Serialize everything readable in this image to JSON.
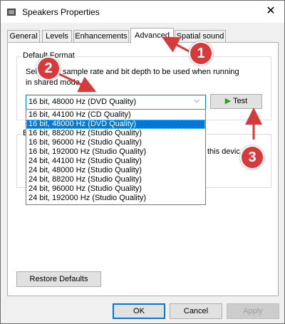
{
  "window": {
    "title": "Speakers Properties",
    "close_glyph": "✕"
  },
  "tabs": [
    {
      "label": "General"
    },
    {
      "label": "Levels"
    },
    {
      "label": "Enhancements"
    },
    {
      "label": "Advanced",
      "active": true
    },
    {
      "label": "Spatial sound"
    }
  ],
  "default_format": {
    "group_label": "Default Format",
    "description_line1": "Select the sample rate and bit depth to be used when running",
    "description_line2": "in shared mode.",
    "selected_value": "16 bit, 48000 Hz (DVD Quality)",
    "test_button_label": "Test",
    "options": [
      "16 bit, 44100 Hz (CD Quality)",
      "16 bit, 48000 Hz (DVD Quality)",
      "16 bit, 88200 Hz (Studio Quality)",
      "16 bit, 96000 Hz (Studio Quality)",
      "16 bit, 192000 Hz (Studio Quality)",
      "24 bit, 44100 Hz (Studio Quality)",
      "24 bit, 48000 Hz (Studio Quality)",
      "24 bit, 88200 Hz (Studio Quality)",
      "24 bit, 96000 Hz (Studio Quality)",
      "24 bit, 192000 Hz (Studio Quality)"
    ],
    "selected_index": 1
  },
  "exclusive_mode": {
    "group_label_partial": "E",
    "text_partial": "this devic"
  },
  "buttons": {
    "restore_defaults": "Restore Defaults",
    "ok": "OK",
    "cancel": "Cancel",
    "apply": "Apply"
  },
  "annotations": [
    {
      "number": "1"
    },
    {
      "number": "2"
    },
    {
      "number": "3"
    }
  ],
  "colors": {
    "accent": "#0078d7",
    "annotation_red": "#d63a3a",
    "play_green": "#2e9d2e"
  },
  "icons": {
    "app_icon": "speaker-icon",
    "test_icon": "play-icon",
    "combo_arrow": "chevron-down-icon"
  }
}
